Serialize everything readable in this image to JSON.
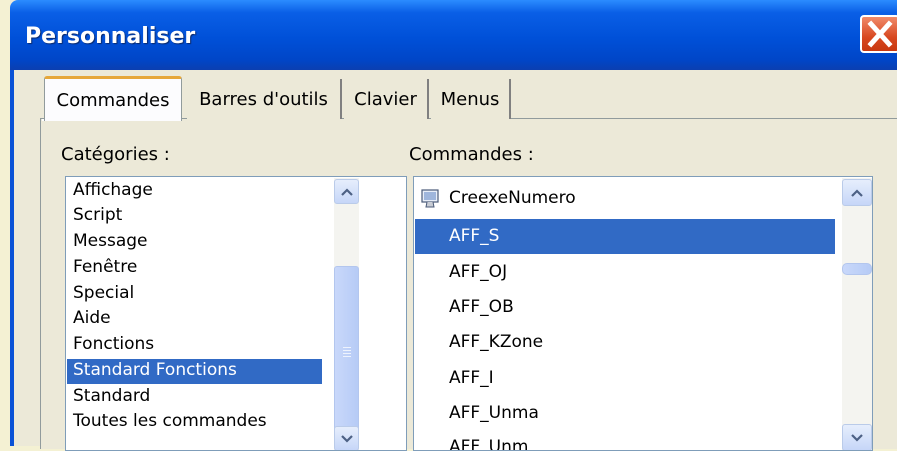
{
  "window": {
    "title": "Personnaliser"
  },
  "tabs": [
    {
      "label": "Commandes",
      "active": true
    },
    {
      "label": "Barres d'outils",
      "active": false
    },
    {
      "label": "Clavier",
      "active": false
    },
    {
      "label": "Menus",
      "active": false
    }
  ],
  "categories": {
    "label": "Catégories :",
    "items": [
      "Affichage",
      "Script",
      "Message",
      "Fenêtre",
      "Special",
      "Aide",
      "Fonctions",
      "Standard Fonctions",
      "Standard",
      "Toutes les commandes"
    ],
    "selected": "Standard Fonctions"
  },
  "commands": {
    "label": "Commandes :",
    "items": [
      "CreexeNumero",
      "AFF_S",
      "AFF_OJ",
      "AFF_OB",
      "AFF_KZone",
      "AFF_I",
      "AFF_Unma",
      "AFF_Unm"
    ],
    "selected": "AFF_S"
  },
  "colors": {
    "selection": "#316ac5",
    "titlebar": "#0050d8",
    "tab_highlight": "#e6a73a"
  },
  "icons": {
    "close": "close-icon",
    "scroll_up": "chevron-up-icon",
    "scroll_down": "chevron-down-icon",
    "command": "computer-icon"
  }
}
